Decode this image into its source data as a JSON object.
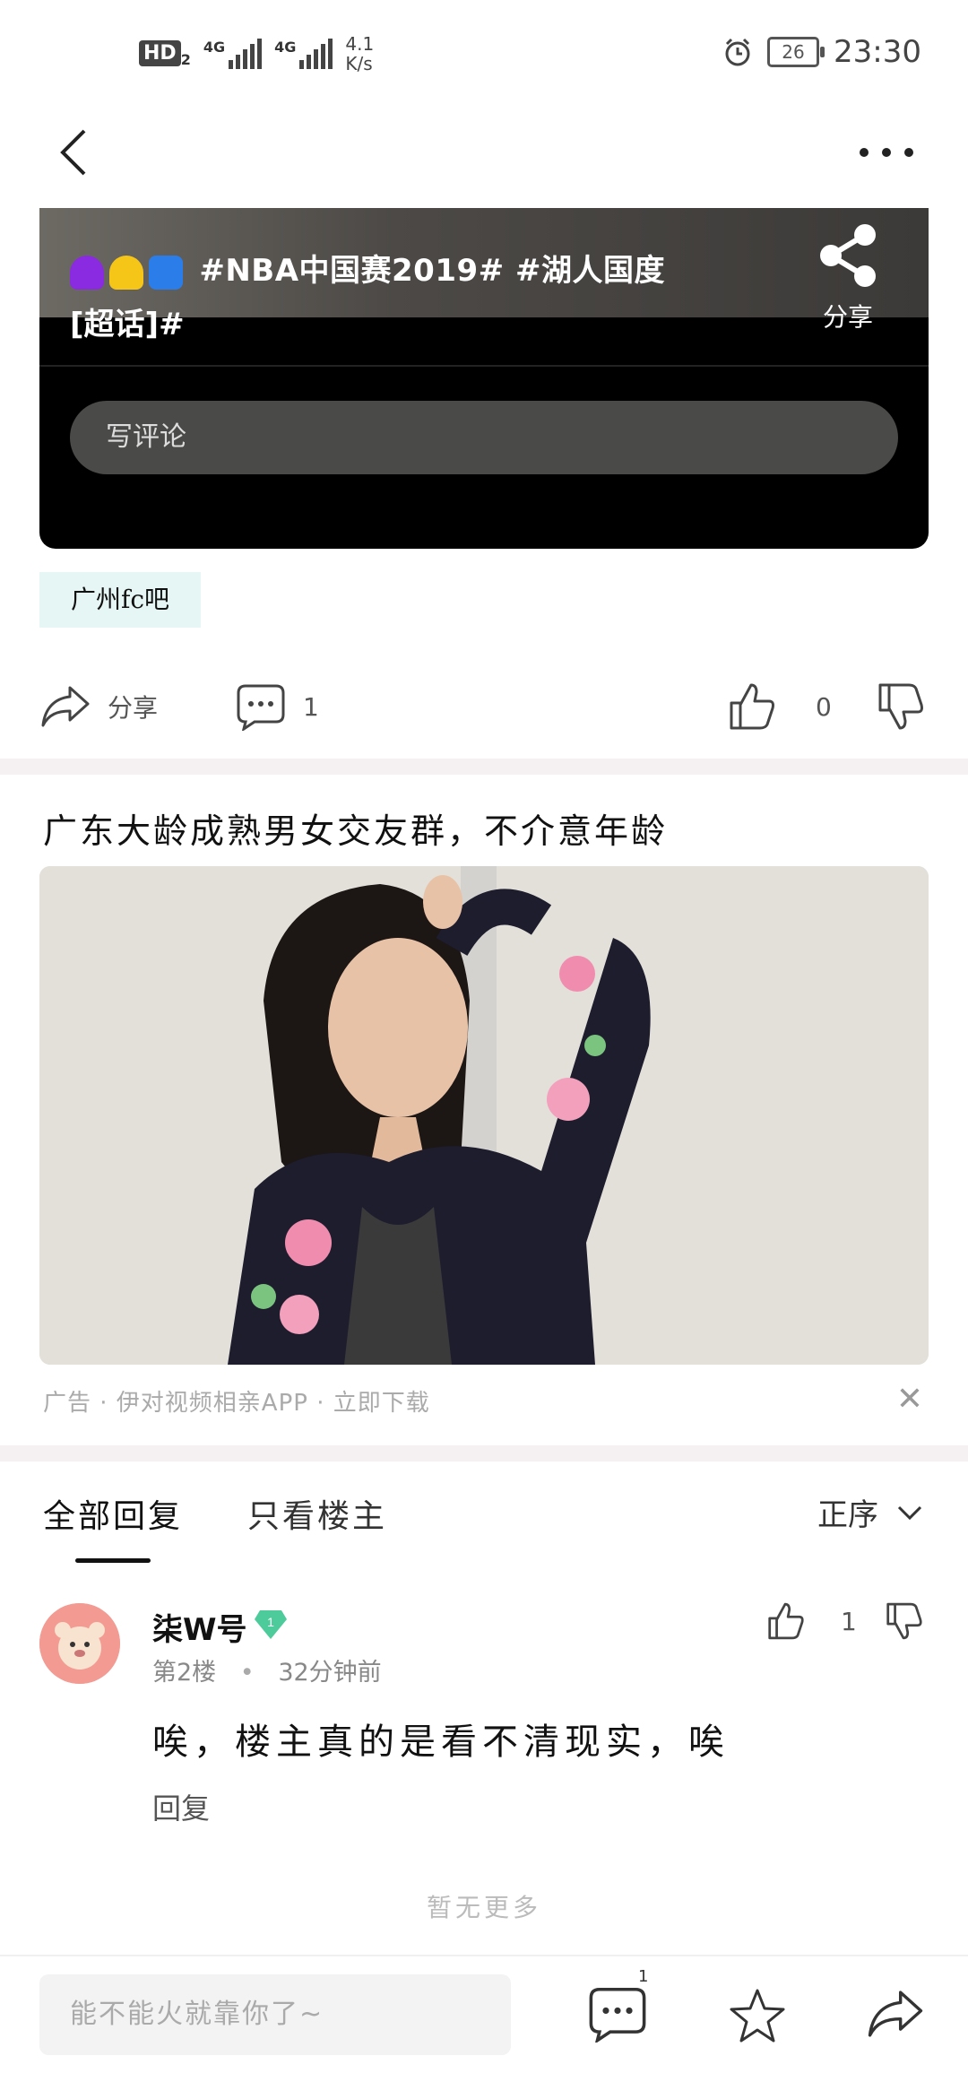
{
  "status_bar": {
    "hd": "HD",
    "hd_sub": "2",
    "net1": "4G",
    "net2": "4G",
    "speed_value": "4.1",
    "speed_unit": "K/s",
    "battery": "26",
    "time": "23:30"
  },
  "video_card": {
    "tagline": "#NBA中国赛2019# #湖人国度",
    "tagline2": "[超话]#",
    "share_label": "分享",
    "comment_placeholder": "写评论"
  },
  "forum_tag": "广州fc吧",
  "actions": {
    "share_label": "分享",
    "comment_count": "1",
    "like_count": "0"
  },
  "ad": {
    "title": "广东大龄成熟男女交友群，不介意年龄",
    "meta": "广告 · 伊对视频相亲APP · 立即下载"
  },
  "tabs": {
    "all_replies": "全部回复",
    "op_only": "只看楼主",
    "sort": "正序"
  },
  "reply": {
    "username": "柒W号",
    "badge": "1",
    "floor": "第2楼",
    "time": "32分钟前",
    "text": "唉，楼主真的是看不清现实，唉",
    "reply_label": "回复",
    "like_count": "1"
  },
  "no_more": "暂无更多",
  "bottom_bar": {
    "input_placeholder": "能不能火就靠你了~",
    "comment_badge": "1"
  }
}
